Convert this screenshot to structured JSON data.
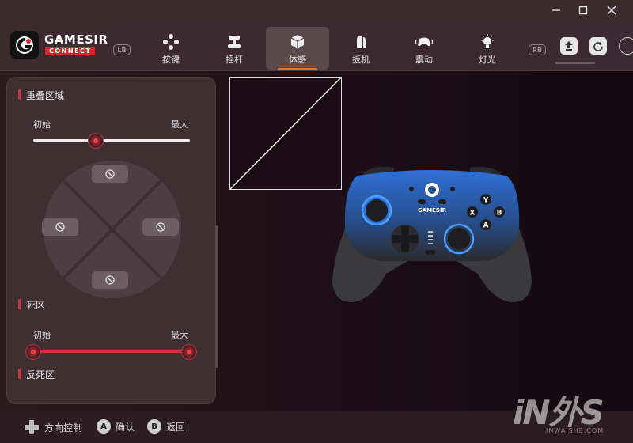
{
  "window": {
    "controls": [
      "minimize",
      "maximize",
      "close"
    ]
  },
  "brand": {
    "name": "GAMESIR",
    "sub": "CONNECT"
  },
  "bumpers": {
    "left": "LB",
    "right": "RB"
  },
  "tabs": [
    {
      "label": "按键",
      "icon": "buttons-icon",
      "active": false
    },
    {
      "label": "摇杆",
      "icon": "joystick-icon",
      "active": false
    },
    {
      "label": "体感",
      "icon": "motion-cube-icon",
      "active": true
    },
    {
      "label": "扳机",
      "icon": "trigger-icon",
      "active": false
    },
    {
      "label": "震动",
      "icon": "vibration-icon",
      "active": false
    },
    {
      "label": "灯光",
      "icon": "light-bulb-icon",
      "active": false
    }
  ],
  "tools": [
    "upload-icon",
    "refresh-icon"
  ],
  "overlap_section": {
    "title": "重叠区域",
    "min_label": "初始",
    "max_label": "最大",
    "value": 0.4
  },
  "deadzone_section": {
    "title": "死区",
    "min_label": "初始",
    "max_label": "最大",
    "range": [
      0,
      1
    ]
  },
  "anti_deadzone_section": {
    "title": "反死区"
  },
  "controller": {
    "brand_text": "GAMESIR",
    "buttons": [
      "Y",
      "X",
      "B",
      "A"
    ],
    "accent": "#2f6fd6"
  },
  "footer": {
    "hints": [
      {
        "key": "dpad",
        "label": "方向控制"
      },
      {
        "key": "A",
        "label": "确认"
      },
      {
        "key": "B",
        "label": "返回"
      }
    ]
  },
  "watermark": {
    "text": "iN外S",
    "sub": "INWAISHE.COM"
  },
  "colors": {
    "accent_red": "#d8303a",
    "tab_underline": "#e27522",
    "panel_bg": "#3e2f33"
  }
}
